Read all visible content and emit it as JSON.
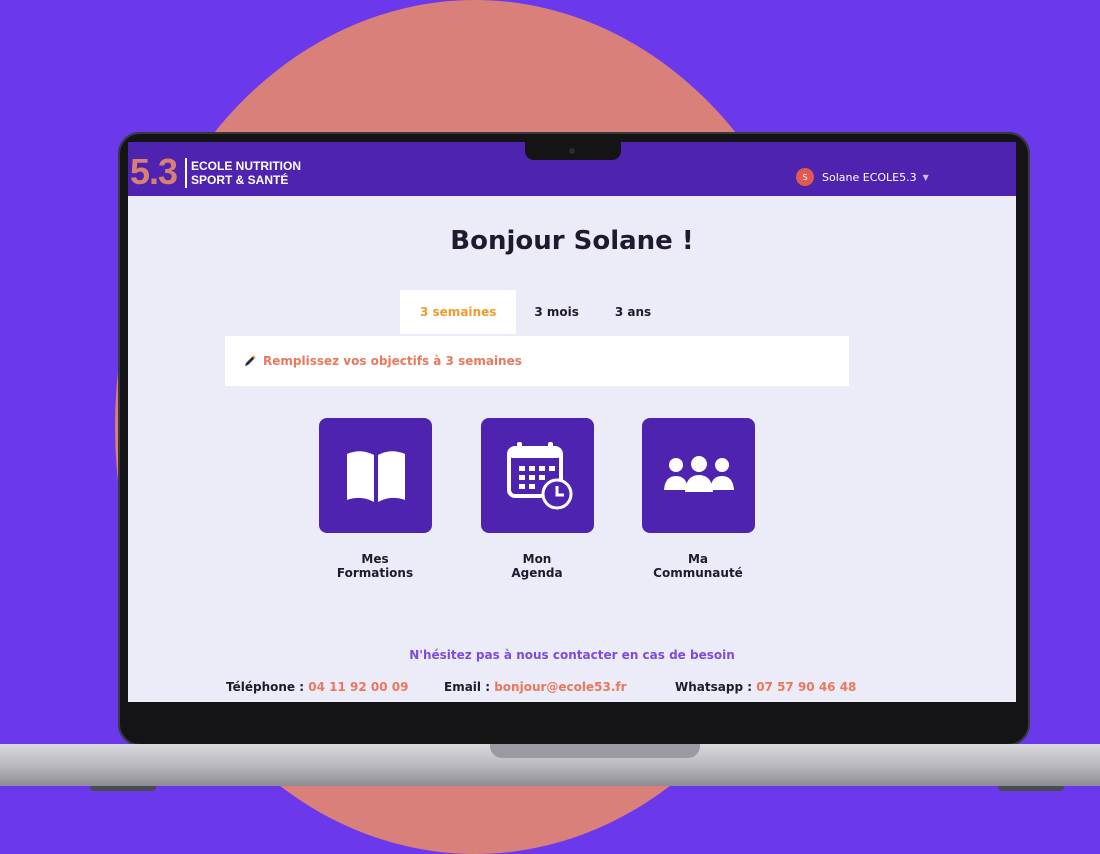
{
  "header": {
    "logo_number": "5.3",
    "logo_line1": "ECOLE NUTRITION",
    "logo_line2": "SPORT & SANTÉ",
    "user_initial": "S",
    "user_name": "Solane ECOLE5.3"
  },
  "main": {
    "greeting": "Bonjour Solane !",
    "tabs": [
      {
        "label": "3 semaines",
        "active": true
      },
      {
        "label": "3 mois",
        "active": false
      },
      {
        "label": "3 ans",
        "active": false
      }
    ],
    "objectives_text": "Remplissez vos objectifs à 3 semaines",
    "tiles": [
      {
        "line1": "Mes",
        "line2": "Formations",
        "icon": "book-icon"
      },
      {
        "line1": "Mon",
        "line2": "Agenda",
        "icon": "calendar-icon"
      },
      {
        "line1": "Ma",
        "line2": "Communauté",
        "icon": "people-icon"
      }
    ]
  },
  "contact": {
    "title": "N'hésitez pas à nous contacter en cas de besoin",
    "phone_label": "Téléphone :",
    "phone_value": "04 11 92 00 09",
    "email_label": "Email :",
    "email_value": "bonjour@ecole53.fr",
    "whatsapp_label": "Whatsapp :",
    "whatsapp_value": "07 57 90 46 48"
  },
  "colors": {
    "page_background": "#6c38ec",
    "circle": "#d88079",
    "topbar": "#4d23b0",
    "tab_active": "#f39a2b",
    "accent_text": "#e8795d",
    "contact_title": "#7b4ce0"
  }
}
